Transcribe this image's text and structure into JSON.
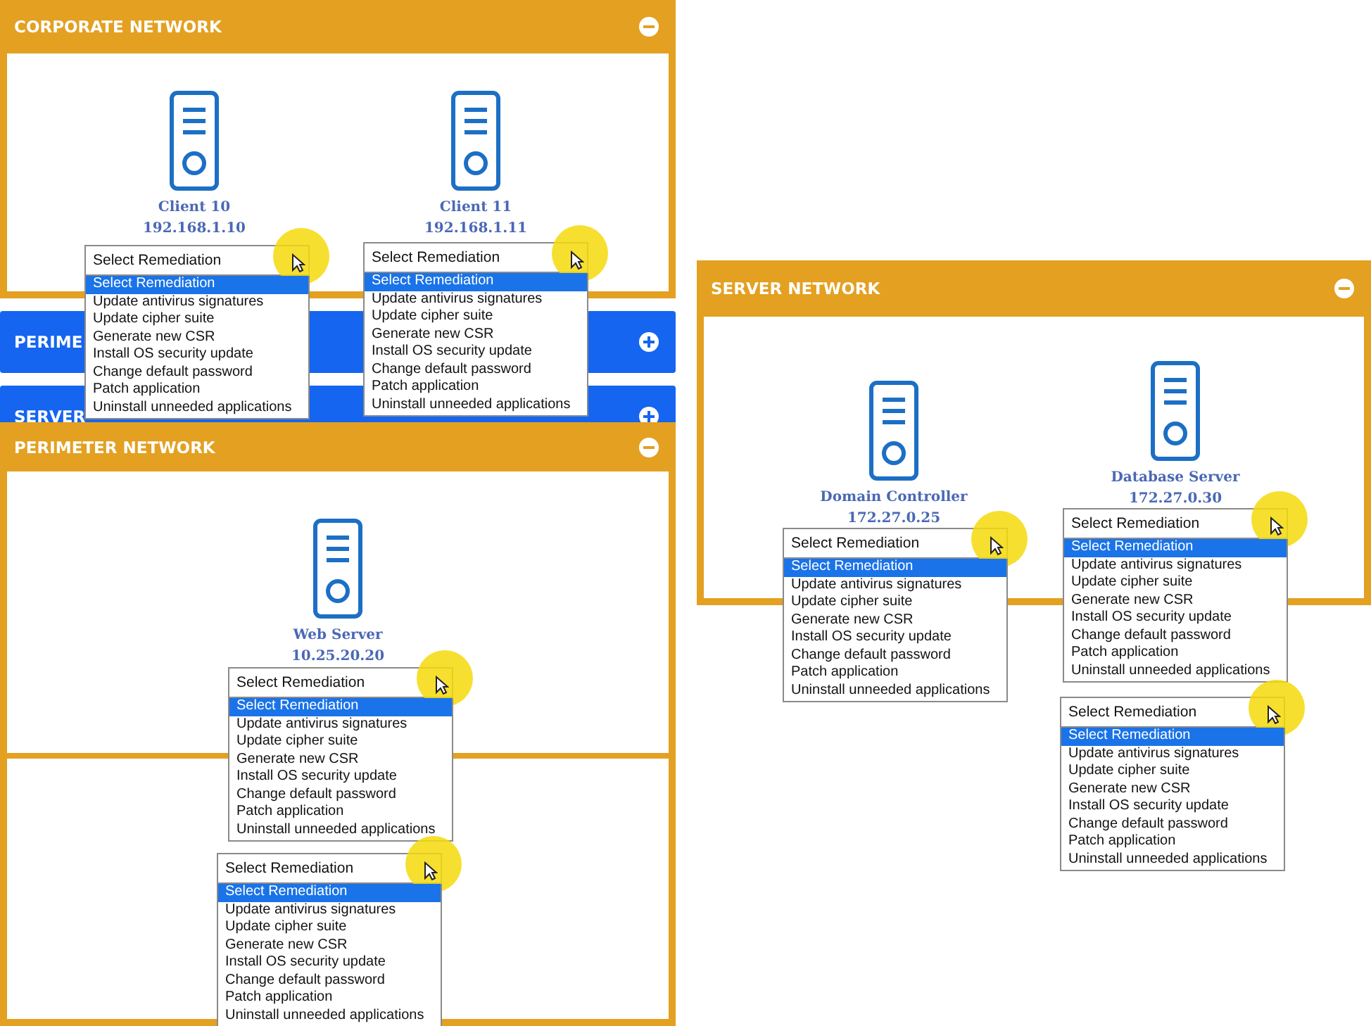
{
  "screens": [
    {
      "panels": [
        {
          "title": "CORPORATE NETWORK",
          "expanded": true,
          "hosts": [
            {
              "name": "Client 10",
              "ip": "192.168.1.10"
            },
            {
              "name": "Client 11",
              "ip": "192.168.1.11"
            }
          ]
        },
        {
          "title": "PERIME",
          "expanded": false
        },
        {
          "title": "SERVER",
          "expanded": false
        }
      ],
      "dropdowns": [
        {
          "value": "Select Remediation",
          "options": [
            {
              "label": "Select Remediation",
              "selected": true
            },
            {
              "label": "Update antivirus signatures",
              "selected": false
            },
            {
              "label": "Update cipher suite",
              "selected": false
            },
            {
              "label": "Generate new CSR",
              "selected": false
            },
            {
              "label": "Install OS security update",
              "selected": false
            },
            {
              "label": "Change default password",
              "selected": false
            },
            {
              "label": "Patch application",
              "selected": false
            },
            {
              "label": "Uninstall unneeded applications",
              "selected": false
            }
          ]
        },
        {
          "value": "Select Remediation",
          "options": [
            {
              "label": "Select Remediation",
              "selected": true
            },
            {
              "label": "Update antivirus signatures",
              "selected": false
            },
            {
              "label": "Update cipher suite",
              "selected": false
            },
            {
              "label": "Generate new CSR",
              "selected": false
            },
            {
              "label": "Install OS security update",
              "selected": false
            },
            {
              "label": "Change default password",
              "selected": false
            },
            {
              "label": "Patch application",
              "selected": false
            },
            {
              "label": "Uninstall unneeded applications",
              "selected": false
            }
          ]
        }
      ]
    },
    {
      "panels": [
        {
          "title": "PERIMETER NETWORK",
          "expanded": true,
          "hosts": [
            {
              "name": "Web Server",
              "ip": "10.25.20.20"
            }
          ]
        }
      ],
      "dropdowns": [
        {
          "value": "Select Remediation",
          "options": [
            {
              "label": "Select Remediation",
              "selected": true
            },
            {
              "label": "Update antivirus signatures",
              "selected": false
            },
            {
              "label": "Update cipher suite",
              "selected": false
            },
            {
              "label": "Generate new CSR",
              "selected": false
            },
            {
              "label": "Install OS security update",
              "selected": false
            },
            {
              "label": "Change default password",
              "selected": false
            },
            {
              "label": "Patch application",
              "selected": false
            },
            {
              "label": "Uninstall unneeded applications",
              "selected": false
            }
          ]
        },
        {
          "value": "Select Remediation",
          "options": [
            {
              "label": "Select Remediation",
              "selected": true
            },
            {
              "label": "Update antivirus signatures",
              "selected": false
            },
            {
              "label": "Update cipher suite",
              "selected": false
            },
            {
              "label": "Generate new CSR",
              "selected": false
            },
            {
              "label": "Install OS security update",
              "selected": false
            },
            {
              "label": "Change default password",
              "selected": false
            },
            {
              "label": "Patch application",
              "selected": false
            },
            {
              "label": "Uninstall unneeded applications",
              "selected": false
            }
          ]
        }
      ]
    },
    {
      "panels": [
        {
          "title": "SERVER NETWORK",
          "expanded": true,
          "hosts": [
            {
              "name": "Domain Controller",
              "ip": "172.27.0.25"
            },
            {
              "name": "Database Server",
              "ip": "172.27.0.30"
            }
          ]
        }
      ],
      "dropdowns": [
        {
          "value": "Select Remediation",
          "options": [
            {
              "label": "Select Remediation",
              "selected": true
            },
            {
              "label": "Update antivirus signatures",
              "selected": false
            },
            {
              "label": "Update cipher suite",
              "selected": false
            },
            {
              "label": "Generate new CSR",
              "selected": false
            },
            {
              "label": "Install OS security update",
              "selected": false
            },
            {
              "label": "Change default password",
              "selected": false
            },
            {
              "label": "Patch application",
              "selected": false
            },
            {
              "label": "Uninstall unneeded applications",
              "selected": false
            }
          ]
        },
        {
          "value": "Select Remediation",
          "options": [
            {
              "label": "Select Remediation",
              "selected": true
            },
            {
              "label": "Update antivirus signatures",
              "selected": false
            },
            {
              "label": "Update cipher suite",
              "selected": false
            },
            {
              "label": "Generate new CSR",
              "selected": false
            },
            {
              "label": "Install OS security update",
              "selected": false
            },
            {
              "label": "Change default password",
              "selected": false
            },
            {
              "label": "Patch application",
              "selected": false
            },
            {
              "label": "Uninstall unneeded applications",
              "selected": false
            }
          ]
        },
        {
          "value": "Select Remediation",
          "options": [
            {
              "label": "Select Remediation",
              "selected": true
            },
            {
              "label": "Update antivirus signatures",
              "selected": false
            },
            {
              "label": "Update cipher suite",
              "selected": false
            },
            {
              "label": "Generate new CSR",
              "selected": false
            },
            {
              "label": "Install OS security update",
              "selected": false
            },
            {
              "label": "Change default password",
              "selected": false
            },
            {
              "label": "Patch application",
              "selected": false
            },
            {
              "label": "Uninstall unneeded applications",
              "selected": false
            }
          ]
        }
      ]
    }
  ]
}
